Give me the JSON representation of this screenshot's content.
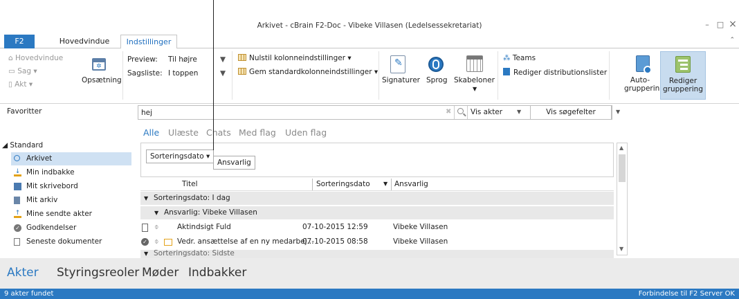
{
  "window": {
    "title": "Arkivet - cBrain F2-Doc - Vibeke Villasen (Ledelsessekretariat)",
    "minimize": "–",
    "maximize": "□",
    "close": "×"
  },
  "tabs": {
    "f2": "F2",
    "hovedvindue": "Hovedvindue",
    "indstillinger": "Indstillinger",
    "collapse": "⌃"
  },
  "ribbon": {
    "hovedvindue": "Hovedvindue",
    "sag": "Sag",
    "akt": "Akt",
    "opsaetning": "Opsætning",
    "preview_label": "Preview:",
    "preview_value": "Til højre",
    "sagsliste_label": "Sagsliste:",
    "sagsliste_value": "I toppen",
    "nulstil": "Nulstil kolonneindstillinger",
    "gem": "Gem standardkolonneindstillinger",
    "signaturer": "Signaturer",
    "sprog": "Sprog",
    "skabeloner": "Skabeloner",
    "teams": "Teams",
    "rediger_dist": "Rediger distributionslister",
    "autogruppering_1": "Auto-",
    "autogruppering_2": "gruppering",
    "rediger_grp_1": "Rediger",
    "rediger_grp_2": "gruppering",
    "dropdown": "▾"
  },
  "nav": {
    "favoritter": "Favoritter",
    "standard": "Standard",
    "items": [
      "Arkivet",
      "Min indbakke",
      "Mit skrivebord",
      "Mit arkiv",
      "Mine sendte akter",
      "Godkendelser",
      "Seneste dokumenter"
    ]
  },
  "search": {
    "value": "hej",
    "vis_akter": "Vis akter",
    "vis_soegefelter": "Vis søgefelter",
    "clear": "✖",
    "dropdown": "▼"
  },
  "filters": [
    "Alle",
    "Ulæste",
    "Chats",
    "Med flag",
    "Uden flag"
  ],
  "grouping": {
    "chip1": "Sorteringsdato ▾",
    "chip2": "Ansvarlig"
  },
  "columns": {
    "titel": "Titel",
    "sorteringsdato": "Sorteringsdato",
    "ansvarlig": "Ansvarlig",
    "sort_arrow": "▼"
  },
  "list": {
    "group1": "Sorteringsdato: I dag",
    "subgroup1": "Ansvarlig: Vibeke Villasen",
    "rows": [
      {
        "title": "Aktindsigt Fuld",
        "date": "07-10-2015 12:59",
        "owner": "Vibeke Villasen"
      },
      {
        "title": "Vedr. ansættelse af en ny medarbej...",
        "date": "07-10-2015 08:58",
        "owner": "Vibeke Villasen"
      }
    ],
    "group2": "Sorteringsdato: Sidste"
  },
  "modes": [
    "Akter",
    "Styringsreoler",
    "Møder",
    "Indbakker"
  ],
  "status": {
    "left": "9 akter fundet",
    "right": "Forbindelse til F2 Server OK"
  },
  "colors": {
    "accent": "#2b79c2",
    "selected": "#cfe1f3"
  }
}
